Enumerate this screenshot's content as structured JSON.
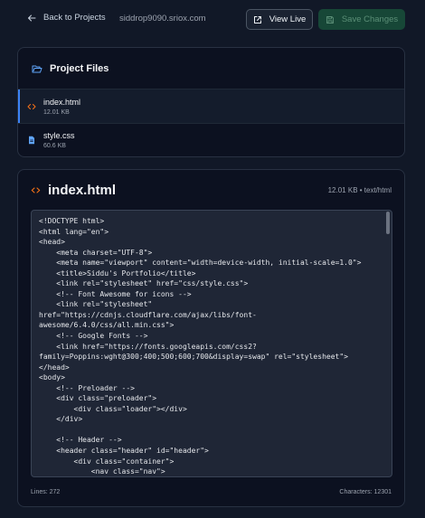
{
  "header": {
    "back_label": "Back to Projects",
    "site_url": "siddrop9090.sriox.com",
    "view_live_label": "View Live",
    "save_label": "Save Changes"
  },
  "files_panel": {
    "title": "Project Files",
    "files": [
      {
        "name": "index.html",
        "size": "12.01 KB",
        "icon": "code-icon",
        "active": true
      },
      {
        "name": "style.css",
        "size": "60.6 KB",
        "icon": "file-icon",
        "active": false
      }
    ]
  },
  "editor": {
    "filename": "index.html",
    "meta": "12.01 KB • text/html",
    "lines_label": "Lines: 272",
    "chars_label": "Characters: 12301",
    "code_lines": [
      "<!DOCTYPE html>",
      "<html lang=\"en\">",
      "<head>",
      "    <meta charset=\"UTF-8\">",
      "    <meta name=\"viewport\" content=\"width=device-width, initial-scale=1.0\">",
      "    <title>Siddu's Portfolio</title>",
      "    <link rel=\"stylesheet\" href=\"css/style.css\">",
      "    <!-- Font Awesome for icons -->",
      "    <link rel=\"stylesheet\"",
      "href=\"https://cdnjs.cloudflare.com/ajax/libs/font-",
      "awesome/6.4.0/css/all.min.css\">",
      "    <!-- Google Fonts -->",
      "    <link href=\"https://fonts.googleapis.com/css2?",
      "family=Poppins:wght@300;400;500;600;700&display=swap\" rel=\"stylesheet\">",
      "</head>",
      "<body>",
      "    <!-- Preloader -->",
      "    <div class=\"preloader\">",
      "        <div class=\"loader\"></div>",
      "    </div>",
      "",
      "    <!-- Header -->",
      "    <header class=\"header\" id=\"header\">",
      "        <div class=\"container\">",
      "            <nav class=\"nav\">"
    ]
  },
  "colors": {
    "background": "#111827",
    "card": "#0c1120",
    "accent_blue": "#3b82f6",
    "save_bg": "#174737",
    "code_icon": "#f97316",
    "folder_icon": "#60a5fa"
  }
}
